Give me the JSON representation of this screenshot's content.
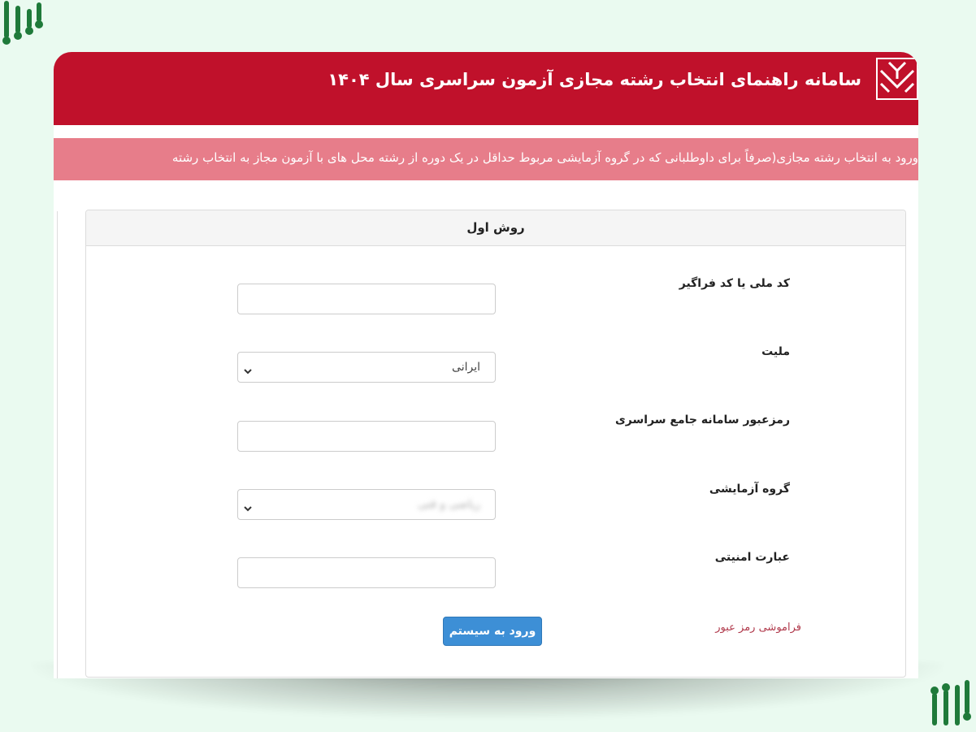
{
  "header": {
    "title": "سامانه راهنمای انتخاب رشته مجازی آزمون سراسری سال ۱۴۰۴"
  },
  "ticker": {
    "text": "ورود به انتخاب رشته مجازی(صرفاً برای داوطلبانی که در گروه آزمایشی مربوط حداقل در یک دوره از رشته محل های با آزمون مجاز به انتخاب رشته"
  },
  "form": {
    "heading": "روش اول",
    "national_code_label": "کد ملی یا کد فراگیر",
    "national_code_value": "",
    "nationality_label": "ملیت",
    "nationality_value": "ایرانی",
    "password_label": "رمزعبور سامانه جامع سراسری",
    "password_value": "",
    "group_label": "گروه آزمایشی",
    "group_value": "ریاضی و فنی",
    "captcha_label": "عبارت امنیتی",
    "captcha_value": "",
    "forgot_password": "فراموشی رمز عبور",
    "login_button": "ورود به سیستم"
  },
  "colors": {
    "header_bg": "#c0112b",
    "ticker_bg": "#e77d8a",
    "page_bg": "#eafaf0",
    "accent_green": "#1f7a3a",
    "button_bg": "#3d8fd6"
  },
  "icons": [
    "brand-logo-icon",
    "header-logo-icon",
    "chevron-down-icon"
  ]
}
